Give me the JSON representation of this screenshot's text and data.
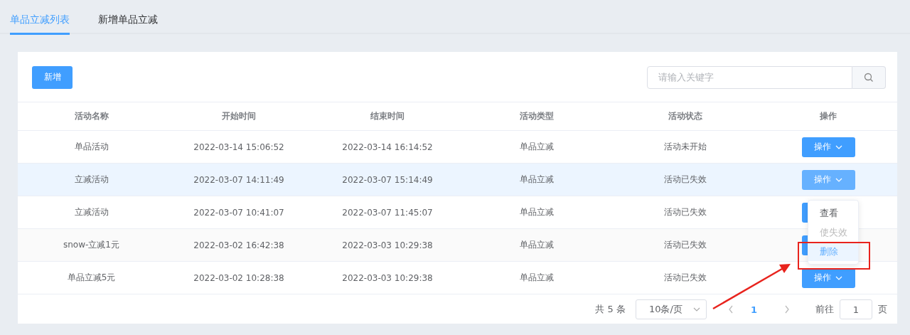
{
  "tabs": [
    {
      "label": "单品立减列表",
      "selected": true
    },
    {
      "label": "新增单品立减",
      "selected": false
    }
  ],
  "toolbar": {
    "add_button": "新增",
    "search": {
      "placeholder": "请输入关键字"
    }
  },
  "table": {
    "columns": [
      "活动名称",
      "开始时间",
      "结束时间",
      "活动类型",
      "活动状态",
      "操作"
    ],
    "rows": [
      {
        "cells": [
          "单品活动",
          "2022-03-14 15:06:52",
          "2022-03-14 16:14:52",
          "单品立减",
          "活动未开始"
        ],
        "action": "操作",
        "highlighted": false
      },
      {
        "cells": [
          "立减活动",
          "2022-03-07 14:11:49",
          "2022-03-07 15:14:49",
          "单品立减",
          "活动已失效"
        ],
        "action": "操作",
        "highlighted": true
      },
      {
        "cells": [
          "立减活动",
          "2022-03-07 10:41:07",
          "2022-03-07 11:45:07",
          "单品立减",
          "活动已失效"
        ],
        "highlighted": false
      },
      {
        "cells": [
          "snow-立减1元",
          "2022-03-02 16:42:38",
          "2022-03-03 10:29:38",
          "单品立减",
          "活动已失效"
        ],
        "highlighted": false
      },
      {
        "cells": [
          "单品立减5元",
          "2022-03-02 10:28:38",
          "2022-03-03 10:29:38",
          "单品立减",
          "活动已失效"
        ],
        "action": "操作",
        "highlighted": false
      }
    ]
  },
  "dropdown": {
    "items": [
      {
        "label": "查看",
        "disabled": false,
        "hovered": false
      },
      {
        "label": "使失效",
        "disabled": true,
        "hovered": false
      },
      {
        "label": "删除",
        "disabled": false,
        "hovered": true
      }
    ]
  },
  "pagination": {
    "total": "共 5 条",
    "page_size": "10条/页",
    "pages": [
      {
        "label": "1",
        "selected": true
      }
    ],
    "goto_label": "前往",
    "goto_value": "1",
    "page_suffix": "页"
  }
}
